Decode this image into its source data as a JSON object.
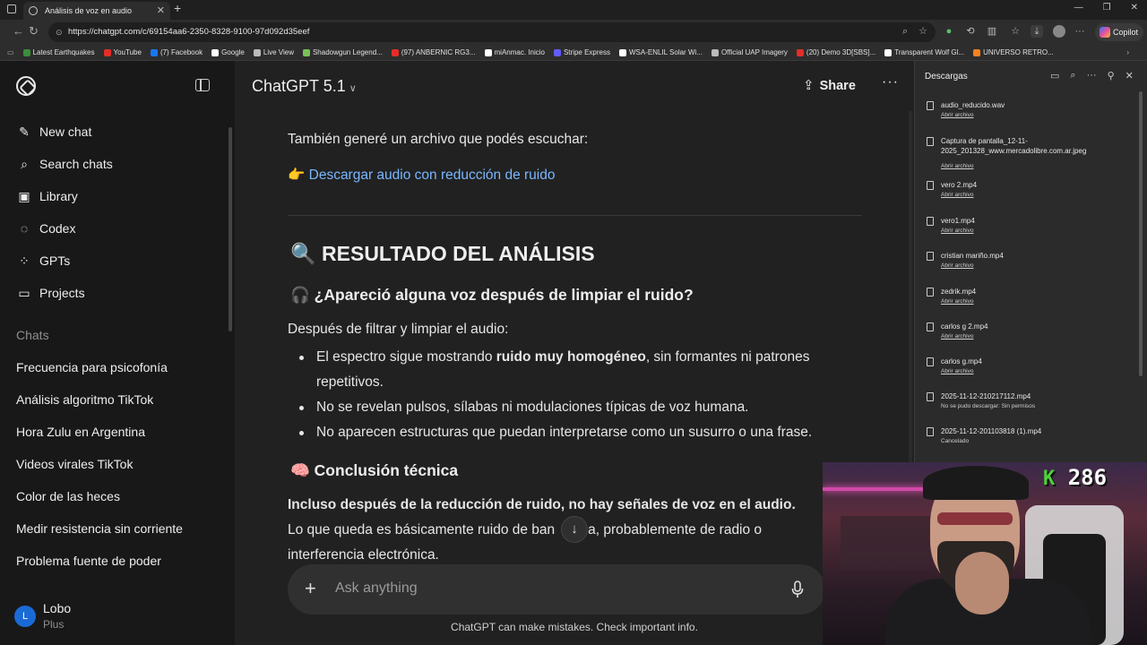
{
  "browser": {
    "tab_title": "Análisis de voz en audio",
    "url": "https://chatgpt.com/c/69154aa6-2350-8328-9100-97d092d35eef",
    "copilot_label": "Copilot",
    "bookmarks": [
      {
        "label": "Latest Earthquakes",
        "color": "#3a8f3a"
      },
      {
        "label": "YouTube",
        "color": "#e52d27"
      },
      {
        "label": "(7) Facebook",
        "color": "#1877f2"
      },
      {
        "label": "Google",
        "color": "#ffffff"
      },
      {
        "label": "Live View",
        "color": "#bbbbbb"
      },
      {
        "label": "Shadowgun Legend...",
        "color": "#78c257"
      },
      {
        "label": "(97) ANBERNIC RG3...",
        "color": "#e52d27"
      },
      {
        "label": "miAnmac. Inicio",
        "color": "#ffffff"
      },
      {
        "label": "Stripe Express",
        "color": "#635bff"
      },
      {
        "label": "WSA-ENLIL Solar Wi...",
        "color": "#ffffff"
      },
      {
        "label": "Official UAP Imagery",
        "color": "#bbbbbb"
      },
      {
        "label": "(20) Demo 3D[SBS]...",
        "color": "#e52d27"
      },
      {
        "label": "Transparent Wolf Gl...",
        "color": "#ffffff"
      },
      {
        "label": "UNIVERSO RETRO...",
        "color": "#f58220"
      }
    ]
  },
  "sidebar": {
    "nav": [
      {
        "label": "New chat",
        "icon": "✎"
      },
      {
        "label": "Search chats",
        "icon": "⌕"
      },
      {
        "label": "Library",
        "icon": "▣"
      },
      {
        "label": "Codex",
        "icon": "◌"
      },
      {
        "label": "GPTs",
        "icon": "⁘"
      },
      {
        "label": "Projects",
        "icon": "▭"
      }
    ],
    "chats_heading": "Chats",
    "chats": [
      "Frecuencia para psicofonía",
      "Análisis algoritmo TikTok",
      "Hora Zulu en Argentina",
      "Videos virales TikTok",
      "Color de las heces",
      "Medir resistencia sin corriente",
      "Problema fuente de poder"
    ],
    "user": {
      "initial": "L",
      "name": "Lobo",
      "plan": "Plus"
    }
  },
  "header": {
    "model": "ChatGPT 5.1",
    "share_label": "Share",
    "more": "···"
  },
  "message": {
    "intro": "También generé un archivo que podés escuchar:",
    "link_emoji": "👉",
    "link_text": "Descargar audio con reducción de ruido",
    "h1_emoji": "🔍",
    "h1": "RESULTADO DEL ANÁLISIS",
    "h2a_emoji": "🎧",
    "h2a": "¿Apareció alguna voz después de limpiar el ruido?",
    "p1": "Después de filtrar y limpiar el audio:",
    "b1_pre": "El espectro sigue mostrando ",
    "b1_bold": "ruido muy homogéneo",
    "b1_post": ", sin formantes ni patrones",
    "b1_line2": "repetitivos.",
    "b2": "No se revelan pulsos, sílabas ni modulaciones típicas de voz humana.",
    "b3": "No aparecen estructuras que puedan interpretarse como un susurro o una frase.",
    "h2b_emoji": "🧠",
    "h2b": "Conclusión técnica",
    "p2_bold": "Incluso después de la reducción de ruido, no hay señales de voz en el audio.",
    "p3_a": "Lo que queda es básicamente ruido de ban",
    "p3_b": "ncha, probablemente de radio o",
    "p3_line2": "interferencia electrónica."
  },
  "composer": {
    "placeholder": "Ask anything",
    "footer": "ChatGPT can make mistakes. Check important info."
  },
  "downloads": {
    "title": "Descargas",
    "items": [
      {
        "name": "audio_reducido.wav",
        "status": "Abrir archivo",
        "link": true
      },
      {
        "name": "Captura de pantalla_12-11-2025_201328_www.mercadolibre.com.ar.jpeg",
        "status": "Abrir archivo",
        "link": true
      },
      {
        "name": "vero 2.mp4",
        "status": "Abrir archivo",
        "link": true
      },
      {
        "name": "vero1.mp4",
        "status": "Abrir archivo",
        "link": true
      },
      {
        "name": "cristian mariño.mp4",
        "status": "Abrir archivo",
        "link": true
      },
      {
        "name": "zedrik.mp4",
        "status": "Abrir archivo",
        "link": true
      },
      {
        "name": "carlos g 2.mp4",
        "status": "Abrir archivo",
        "link": true
      },
      {
        "name": "carlos g.mp4",
        "status": "Abrir archivo",
        "link": true
      },
      {
        "name": "2025-11-12-210217112.mp4",
        "status": "No se pudo descargar: Sin permisos",
        "link": false
      },
      {
        "name": "2025-11-12-201103818 (1).mp4",
        "status": "Cancelado",
        "link": false
      }
    ]
  },
  "overlay": {
    "badge_letter": "K",
    "badge_number": "286"
  }
}
